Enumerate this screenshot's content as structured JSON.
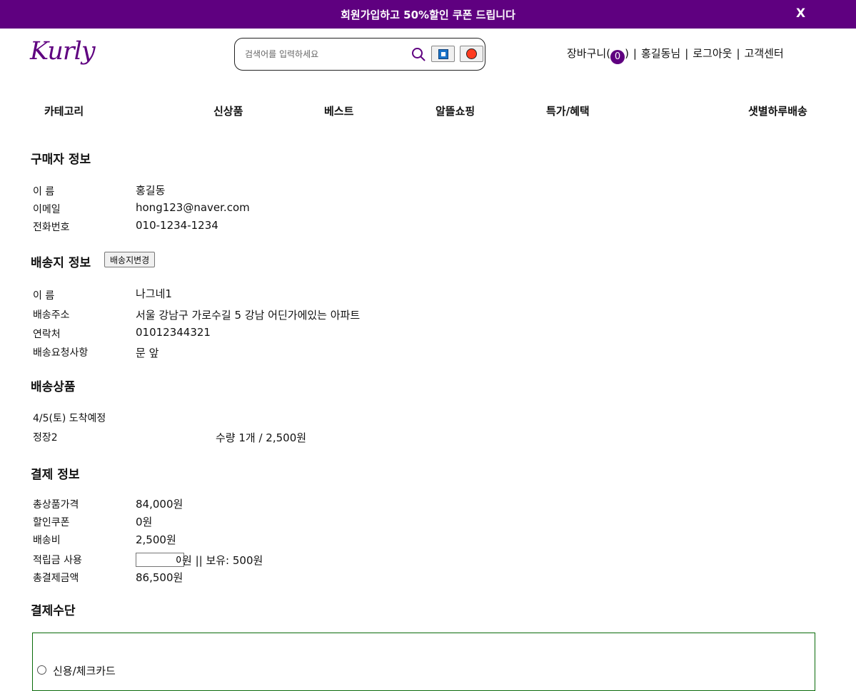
{
  "banner": {
    "text": "회원가입하고 50%할인 쿠폰 드립니다",
    "close": "X"
  },
  "logo": "Kurly",
  "search": {
    "placeholder": "검색어를 입력하세요"
  },
  "user_links": {
    "cart_label": "장바구니",
    "cart_count": "0",
    "user": "홍길동님",
    "logout": "로그아웃",
    "support": "고객센터"
  },
  "nav": [
    "카테고리",
    "신상품",
    "베스트",
    "알뜰쇼핑",
    "특가/혜택",
    "샛별하루배송"
  ],
  "buyer": {
    "title": "구매자 정보",
    "rows": [
      {
        "label": "이 름",
        "value": "홍길동"
      },
      {
        "label": "이메일",
        "value": "hong123@naver.com"
      },
      {
        "label": "전화번호",
        "value": "010-1234-1234"
      }
    ]
  },
  "shipping": {
    "title": "배송지 정보",
    "change_button": "배송지변경",
    "rows": [
      {
        "label": "이 름",
        "value": "나그네1"
      },
      {
        "label": "배송주소",
        "value": "서울 강남구 가로수길 5 강남 어딘가에있는 아파트"
      },
      {
        "label": "연락처",
        "value": "01012344321"
      },
      {
        "label": "배송요청사항",
        "value": "문 앞"
      }
    ]
  },
  "products": {
    "title": "배송상품",
    "arrival": "4/5(토) 도착예정",
    "item_name": "정장2",
    "item_detail": "수량 1개 / 2,500원"
  },
  "payment_info": {
    "title": "결제 정보",
    "rows": [
      {
        "label": "총상품가격",
        "value": "84,000원"
      },
      {
        "label": "할인쿠폰",
        "value": "0원"
      },
      {
        "label": "배송비",
        "value": "2,500원"
      }
    ],
    "points_label": "적립금 사용",
    "points_value": "0",
    "points_suffix": "원 || 보유: 500원",
    "total_label": "총결제금액",
    "total_value": "86,500원"
  },
  "payment_method": {
    "title": "결제수단",
    "option1": "신용/체크카드"
  },
  "colors": {
    "brand": "#5f0080",
    "payment_border": "#0a6b0a"
  }
}
